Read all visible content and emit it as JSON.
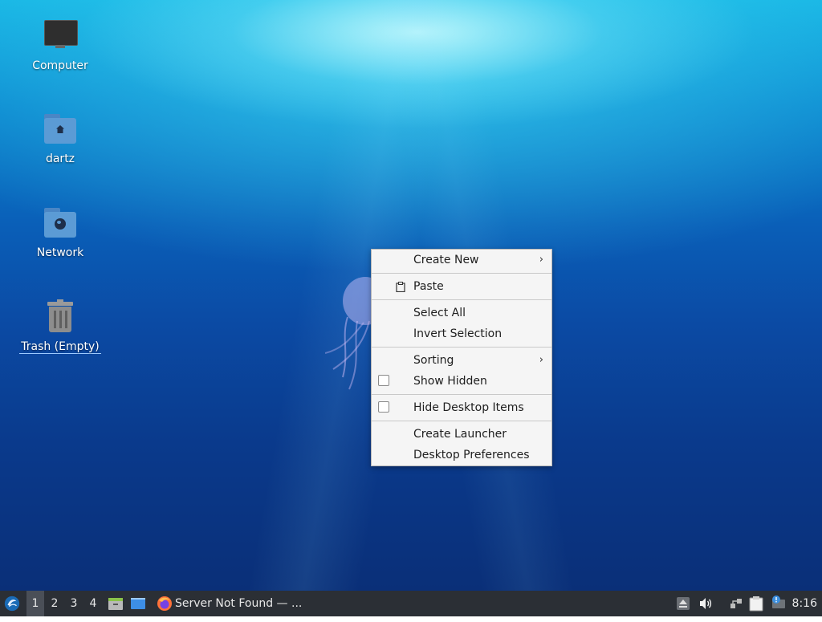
{
  "desktop": {
    "icons": [
      {
        "label": "Computer"
      },
      {
        "label": "dartz"
      },
      {
        "label": "Network"
      },
      {
        "label": "Trash (Empty)"
      }
    ]
  },
  "context_menu": {
    "items": {
      "create_new": "Create New",
      "paste": "Paste",
      "select_all": "Select All",
      "invert_selection": "Invert Selection",
      "sorting": "Sorting",
      "show_hidden": "Show Hidden",
      "hide_desktop_items": "Hide Desktop Items",
      "create_launcher": "Create Launcher",
      "desktop_preferences": "Desktop Preferences"
    },
    "show_hidden_checked": false,
    "hide_desktop_items_checked": false
  },
  "taskbar": {
    "workspaces": [
      "1",
      "2",
      "3",
      "4"
    ],
    "active_workspace": "1",
    "task_title": "Server Not Found — ...",
    "clock": "8:16"
  },
  "colors": {
    "taskbar_bg": "#2b2f35",
    "menu_bg": "#f5f5f5",
    "folder_blue": "#5b9bd5"
  }
}
